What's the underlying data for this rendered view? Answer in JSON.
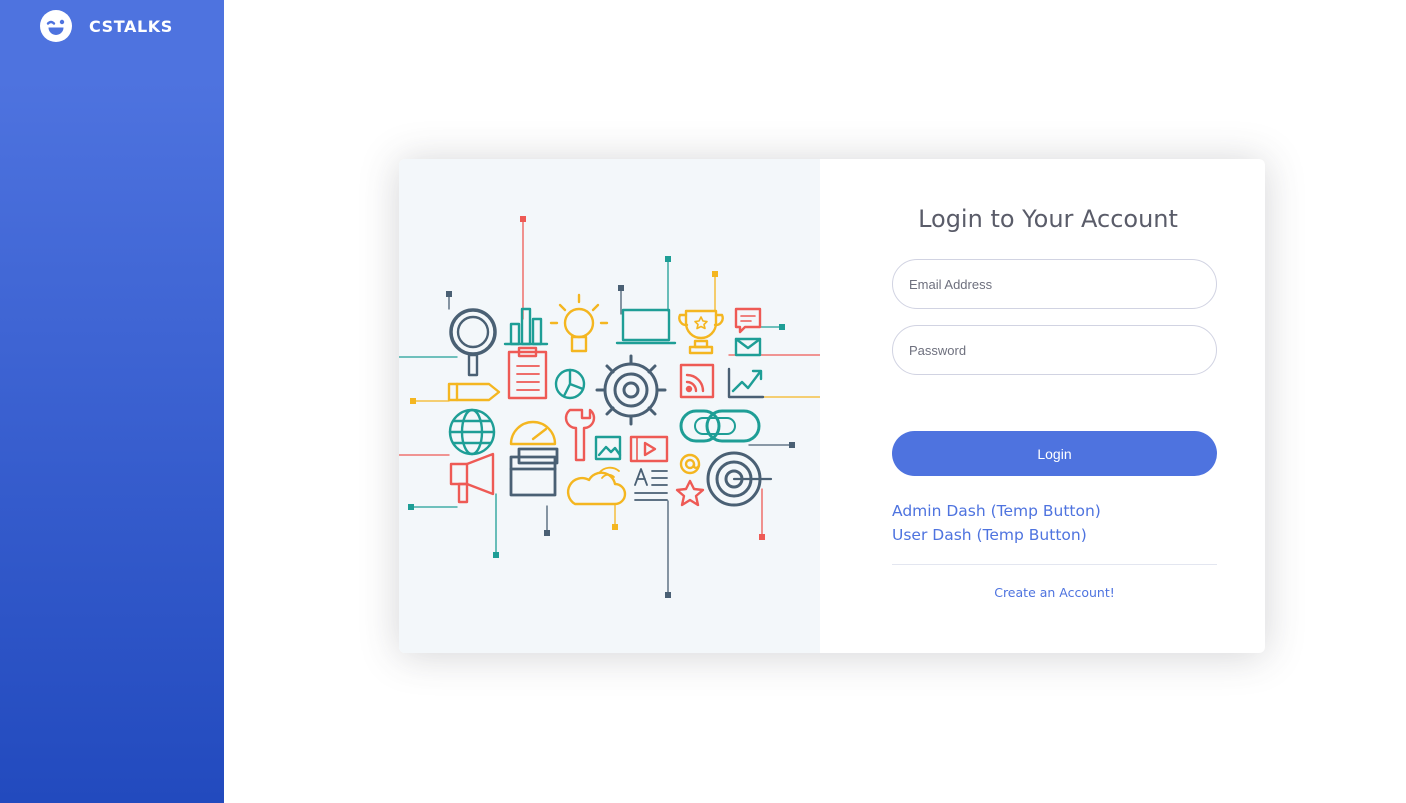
{
  "brand": {
    "name": "CSTALKS",
    "icon": "laughing-wink-icon"
  },
  "login": {
    "title": "Login to Your Account",
    "email_placeholder": "Email Address",
    "password_placeholder": "Password",
    "submit_label": "Login",
    "admin_link": "Admin Dash (Temp Button)",
    "user_link": "User Dash (Temp Button)",
    "create_account": "Create an Account!"
  },
  "illustration": {
    "icon": "tech-icons-illustration"
  },
  "colors": {
    "sidebar_gradient_start": "#4e73df",
    "sidebar_gradient_end": "#224abe",
    "primary": "#4e73df",
    "illustration_bg": "#f3f7fa",
    "teal": "#1e9e96",
    "red": "#ee5a55",
    "yellow": "#f4b620",
    "slate": "#4a6074"
  }
}
